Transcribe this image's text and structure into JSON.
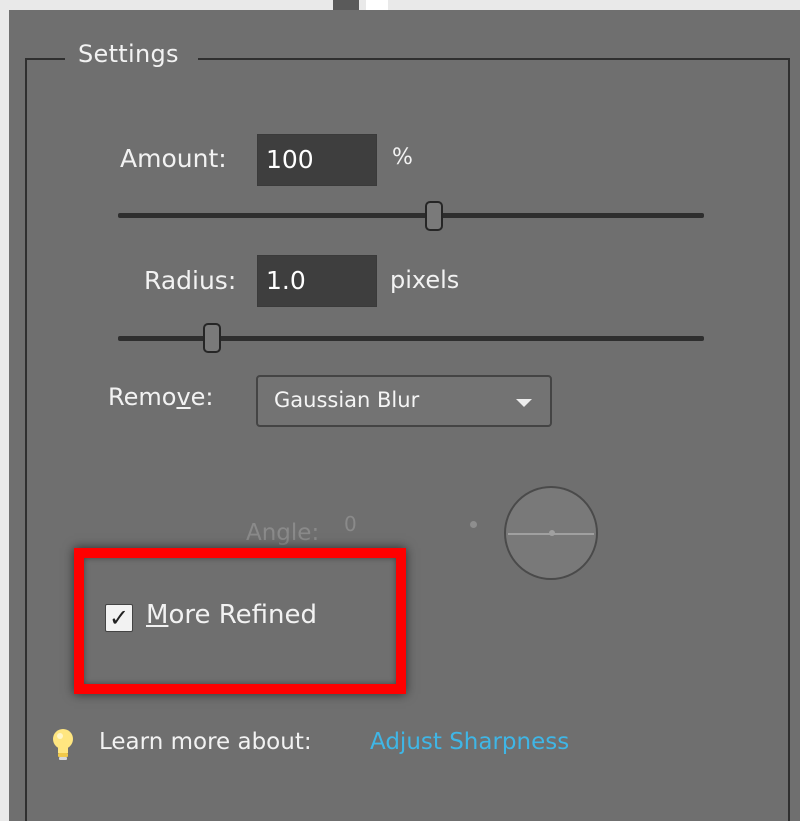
{
  "settings": {
    "legend": "Settings",
    "amount": {
      "label": "Amount:",
      "value": "100",
      "unit": "%",
      "slider_fraction": 0.54
    },
    "radius": {
      "label": "Radius:",
      "value": "1.0",
      "unit": "pixels",
      "slider_fraction": 0.16
    },
    "remove": {
      "label_pre": "Remo",
      "label_accel": "v",
      "label_post": "e:",
      "selected": "Gaussian Blur"
    },
    "angle": {
      "label": "Angle:",
      "value": "0"
    },
    "more_refined": {
      "checked": true,
      "check_glyph": "✓",
      "label_accel": "M",
      "label_rest": "ore Refined"
    }
  },
  "help": {
    "icon": "lightbulb-icon",
    "prefix": "Learn more about:",
    "link": "Adjust Sharpness"
  },
  "colors": {
    "background": "#717171",
    "field": "#3e3e3e",
    "highlight": "#ff0000",
    "link": "#3fb6e6"
  }
}
